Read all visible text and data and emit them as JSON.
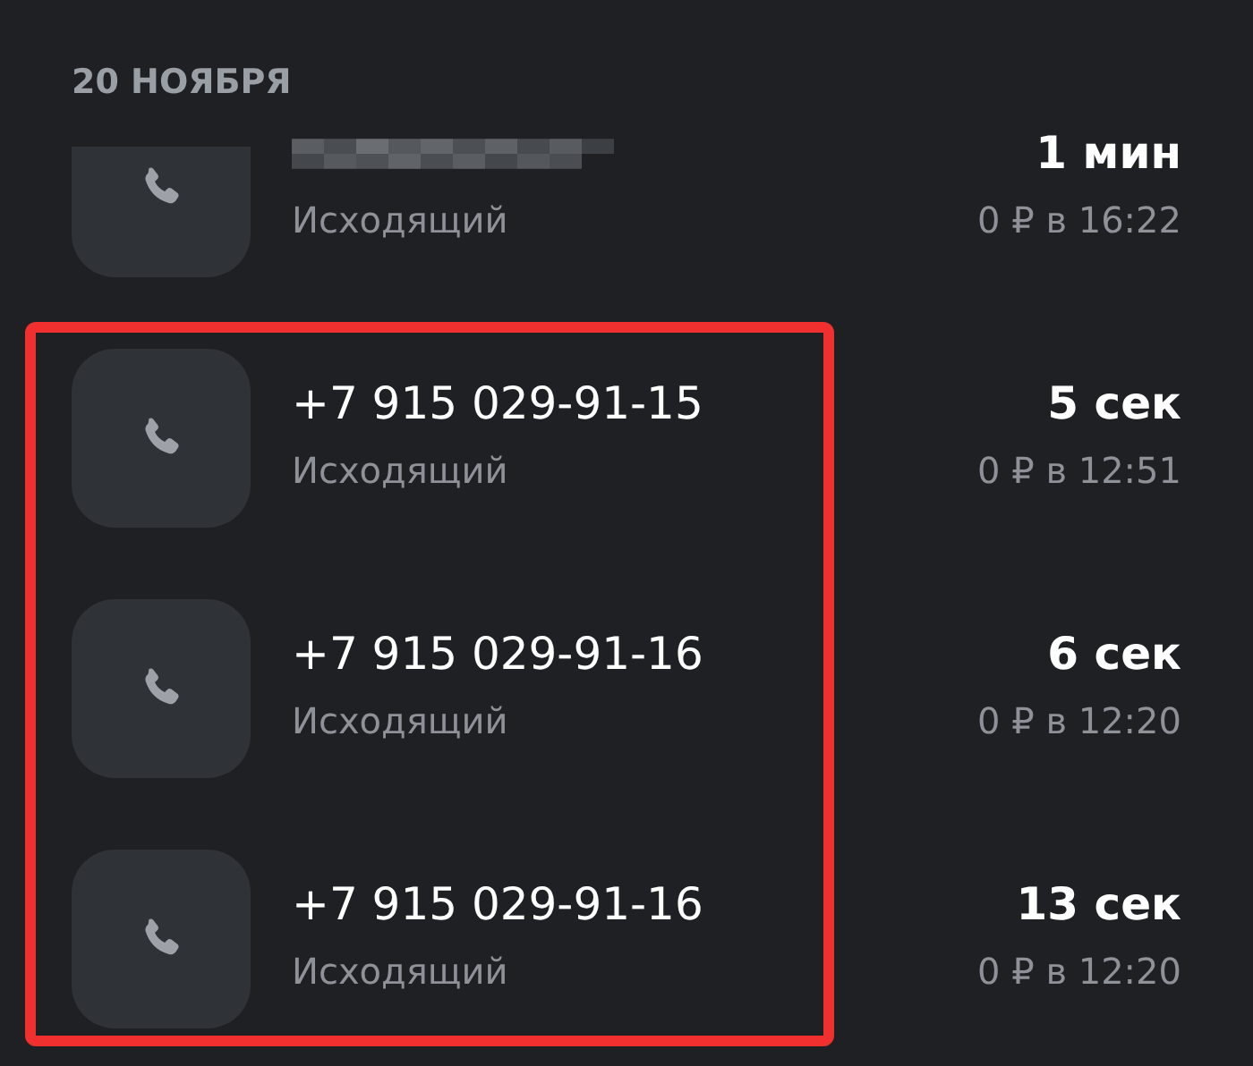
{
  "date_header": "20 НОЯБРЯ",
  "calls": [
    {
      "redacted": true,
      "direction": "Исходящий",
      "duration": "1 мин",
      "details": "0 ₽ в 16:22",
      "highlighted": false
    },
    {
      "redacted": false,
      "number": "+7 915 029-91-15",
      "direction": "Исходящий",
      "duration": "5 сек",
      "details": "0 ₽ в 12:51",
      "highlighted": true
    },
    {
      "redacted": false,
      "number": "+7 915 029-91-16",
      "direction": "Исходящий",
      "duration": "6 сек",
      "details": "0 ₽ в 12:20",
      "highlighted": true
    },
    {
      "redacted": false,
      "number": "+7 915 029-91-16",
      "direction": "Исходящий",
      "duration": "13 сек",
      "details": "0 ₽ в 12:20",
      "highlighted": true
    }
  ]
}
